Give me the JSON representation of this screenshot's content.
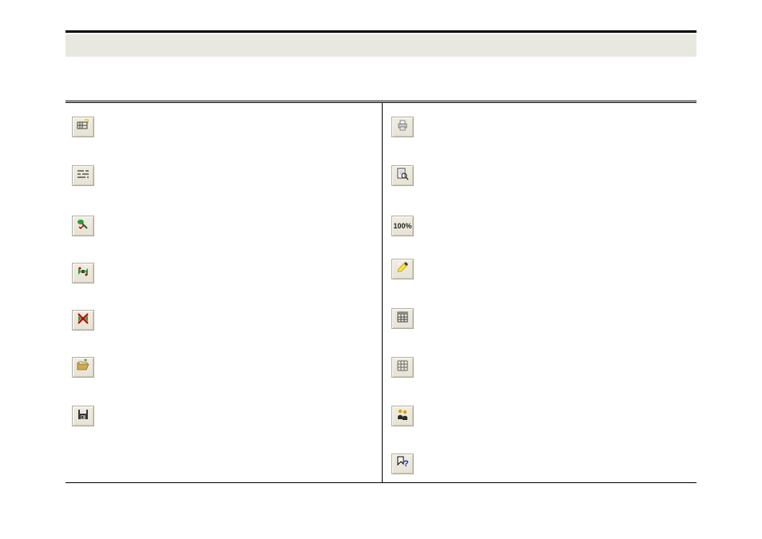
{
  "header": {
    "title": ""
  },
  "icons": {
    "left": [
      {
        "name": "new-crosstab",
        "desc": "new-icon"
      },
      {
        "name": "design-mode",
        "desc": "design-icon"
      },
      {
        "name": "generate-report",
        "desc": "generate-icon"
      },
      {
        "name": "connect",
        "desc": "connect-icon"
      },
      {
        "name": "disconnect",
        "desc": "disconnect-icon"
      },
      {
        "name": "open",
        "desc": "open-icon"
      },
      {
        "name": "save",
        "desc": "save-icon"
      }
    ],
    "right": [
      {
        "name": "print",
        "desc": "print-icon"
      },
      {
        "name": "print-preview",
        "desc": "preview-icon"
      },
      {
        "name": "zoom-100",
        "desc": "zoom-100-icon",
        "label": "100%"
      },
      {
        "name": "highlight-exceptions",
        "desc": "highlight-icon"
      },
      {
        "name": "table-style",
        "desc": "table-style-icon"
      },
      {
        "name": "grid",
        "desc": "grid-icon"
      },
      {
        "name": "statistics",
        "desc": "stats-icon"
      },
      {
        "name": "help",
        "desc": "help-icon"
      }
    ]
  }
}
